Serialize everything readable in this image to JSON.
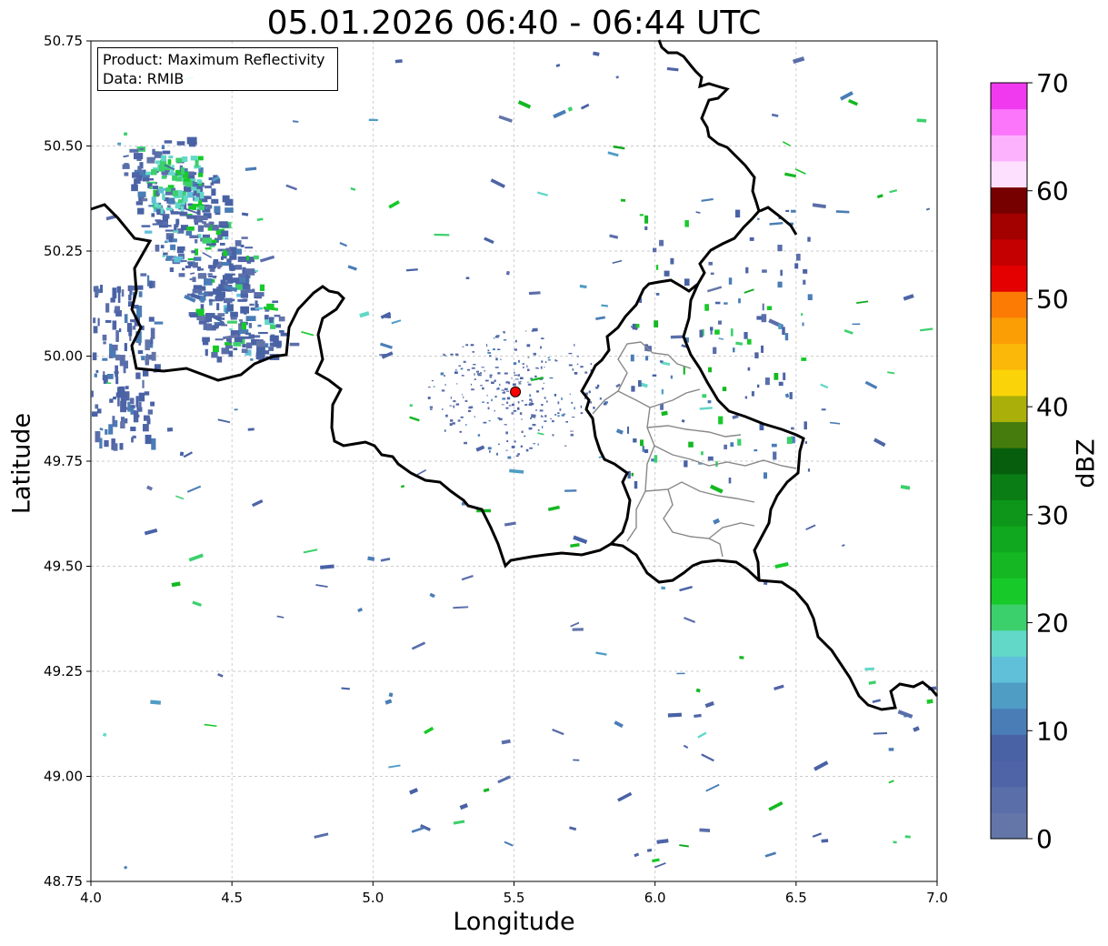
{
  "title": "05.01.2026 06:40 - 06:44 UTC",
  "info_box": {
    "product_line": "Product: Maximum Reflectivity",
    "data_line": "Data: RMIB"
  },
  "axes": {
    "xlabel": "Longitude",
    "ylabel": "Latitude",
    "xlim": [
      4.0,
      7.0
    ],
    "ylim": [
      48.75,
      50.75
    ],
    "xticks": [
      "4.0",
      "4.5",
      "5.0",
      "5.5",
      "6.0",
      "6.5",
      "7.0"
    ],
    "yticks": [
      "48.75",
      "49.00",
      "49.25",
      "49.50",
      "49.75",
      "50.00",
      "50.25",
      "50.50",
      "50.75"
    ],
    "grid": true
  },
  "colorbar": {
    "label": "dBZ",
    "min": 0,
    "max": 70,
    "step": 2.5,
    "ticks": [
      "0",
      "10",
      "20",
      "30",
      "40",
      "50",
      "60",
      "70"
    ],
    "colors": [
      "#6475a8",
      "#5a6eaa",
      "#4e64a6",
      "#4862a5",
      "#4a7db6",
      "#4f9cc5",
      "#60c0da",
      "#62d8c8",
      "#3cd06c",
      "#18c92a",
      "#15b822",
      "#10a81e",
      "#0d961a",
      "#0a7e15",
      "#075f0e",
      "#467c0e",
      "#aab009",
      "#fad408",
      "#fbb808",
      "#fb9e06",
      "#fb7b05",
      "#e40000",
      "#c40000",
      "#a30000",
      "#760000",
      "#fde0fd",
      "#fdb2fd",
      "#fc76fc",
      "#f03af0"
    ]
  },
  "radar_site": {
    "lon": 5.505,
    "lat": 49.915,
    "color": "#ff0000"
  },
  "chart_data": {
    "type": "map",
    "echoes": [
      {
        "lon": 4.28,
        "lat": 50.3,
        "dbz": 8,
        "extent": "large band NW"
      },
      {
        "lon": 4.28,
        "lat": 50.46,
        "dbz": 22,
        "extent": "core"
      },
      {
        "lon": 4.07,
        "lat": 49.95,
        "dbz": 8,
        "extent": "west edge"
      },
      {
        "lon": 6.55,
        "lat": 49.9,
        "dbz": 6,
        "extent": "scattered E"
      }
    ]
  }
}
